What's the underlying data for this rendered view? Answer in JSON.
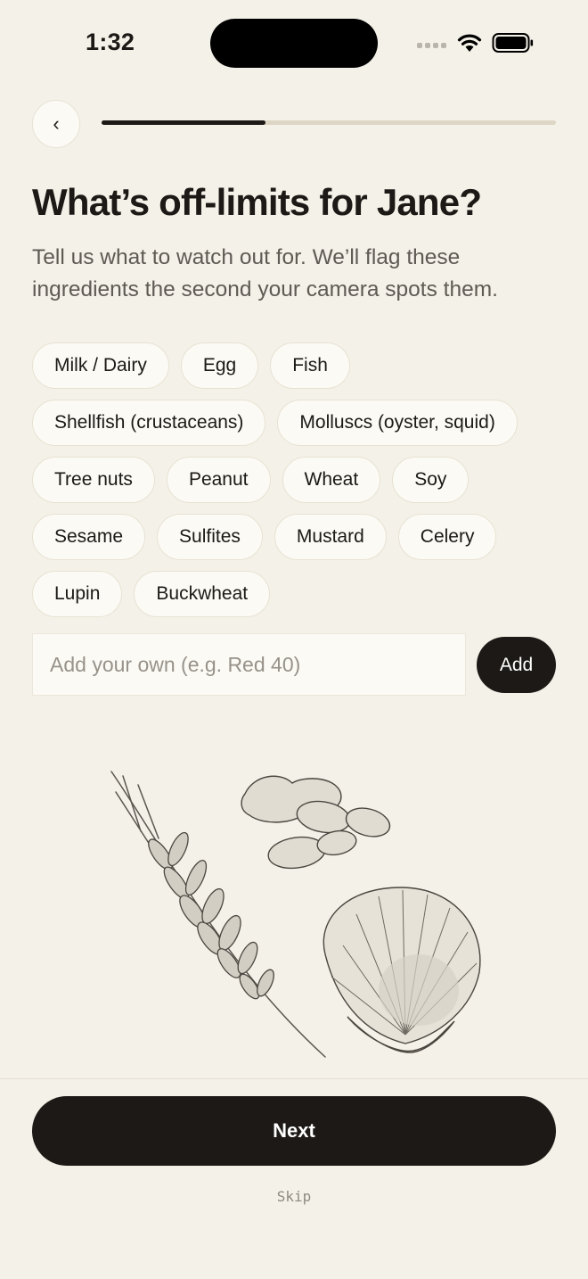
{
  "status_bar": {
    "time": "1:32"
  },
  "nav": {
    "back_label": "‹",
    "progress": 0.36
  },
  "header": {
    "title": "What’s off-limits for Jane?",
    "subtitle": "Tell us what to watch out for. We’ll flag these ingredients the second your camera spots them."
  },
  "allergens": [
    "Milk / Dairy",
    "Egg",
    "Fish",
    "Shellfish (crustaceans)",
    "Molluscs (oyster, squid)",
    "Tree nuts",
    "Peanut",
    "Wheat",
    "Soy",
    "Sesame",
    "Sulfites",
    "Mustard",
    "Celery",
    "Lupin",
    "Buckwheat"
  ],
  "custom": {
    "placeholder": "Add your own (e.g. Red 40)",
    "value": "",
    "add_label": "Add"
  },
  "illustration": {
    "icons": [
      "wheat-icon",
      "peanut-icon",
      "shell-icon"
    ]
  },
  "footer": {
    "next_label": "Next",
    "skip_label": "Skip"
  },
  "colors": {
    "background": "#F4F1E8",
    "primary": "#1C1916",
    "chip": "#FCFAF4",
    "track": "#DDD6C5"
  }
}
